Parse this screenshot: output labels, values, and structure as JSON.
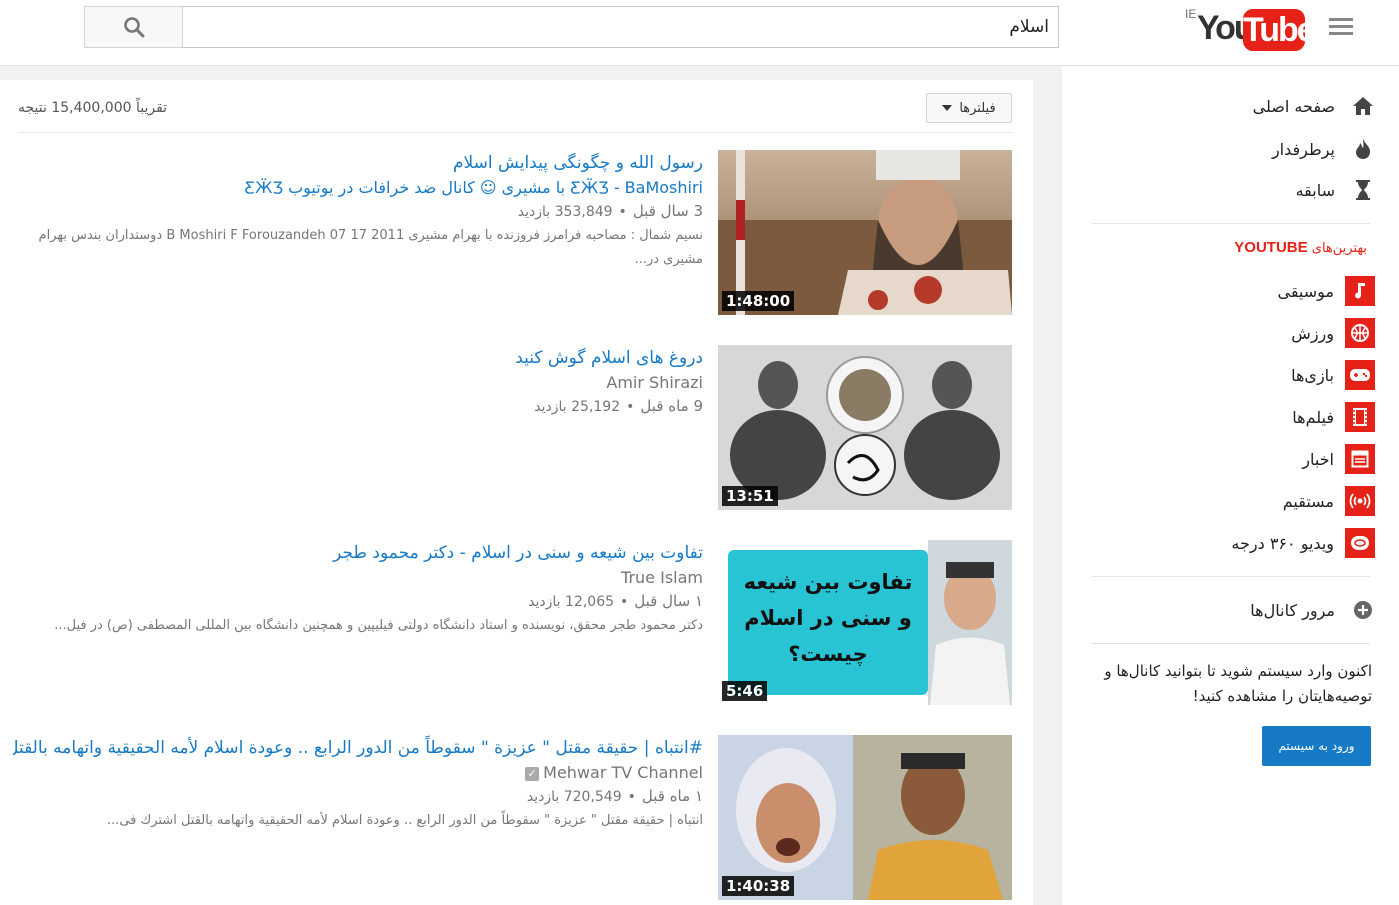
{
  "header": {
    "search_value": "اسلام",
    "logo_ie": "IE",
    "logo_you": "You",
    "logo_tube": "Tube"
  },
  "results": {
    "count_text": "تقریباً 15,400,000 نتیجه",
    "filter_label": "فیلترها",
    "videos": [
      {
        "title": "رسول الله و چگونگی پیدایش اسلام",
        "channel": "ƸӜƷ - BaMoshiri با مشیری ☺ کانال ضد خرافات در یوتیوب ƸӜƷ",
        "time_ago": "3 سال قبل",
        "views": "353,849 بازدید",
        "description": "نسیم شمال : مصاحبه فرامرز فروزنده با بهرام مشیری B Moshiri F Forouzandeh 07 17 2011 دوستداران بندس بهرام مشیری در...",
        "duration": "1:48:00"
      },
      {
        "title": "دروغ های اسلام گوش کنید",
        "channel": "Amir Shirazi",
        "time_ago": "9 ماه قبل",
        "views": "25,192 بازدید",
        "description": "",
        "duration": "13:51"
      },
      {
        "title": "تفاوت بین شیعه و سنی در اسلام - دکتر محمود طجر",
        "channel": "True Islam",
        "time_ago": "۱ سال قبل",
        "views": "12,065 بازدید",
        "description": "دکتر محمود طجر محقق، نویسنده و استاد دانشگاه دولتی فیلیپین و همچنین دانشگاه بین المللی المصطفی (ص) در فیل...",
        "duration": "5:46",
        "thumb_text": "تفاوت بین شیعه و سنی در اسلام چیست؟"
      },
      {
        "title": "#انتباه | حقيقة مقتل \" عزيزة \" سقوطاً من الدور الرابع .. وعودة اسلام لأمه الحقيقية واتهامه بالقتل",
        "channel": "Mehwar TV Channel",
        "time_ago": "۱ ماه قبل",
        "views": "720,549 بازدید",
        "description": "انتباه | حقيقة مقتل \" عزيزة \" سقوطاً من الدور الرابع .. وعودة اسلام لأمه الحقيقية واتهامه بالقتل اشترك فى...",
        "duration": "1:40:38"
      }
    ]
  },
  "sidebar": {
    "nav": [
      {
        "label": "صفحه اصلی",
        "icon": "home-icon"
      },
      {
        "label": "پرطرفدار",
        "icon": "flame-icon"
      },
      {
        "label": "سابقه",
        "icon": "hourglass-icon"
      }
    ],
    "best_title_prefix": "بهترین‌های",
    "best_title_brand": "YOUTUBE",
    "categories": [
      {
        "label": "موسیقی",
        "icon": "music-icon"
      },
      {
        "label": "ورزش",
        "icon": "sports-icon"
      },
      {
        "label": "بازی‌ها",
        "icon": "gamepad-icon"
      },
      {
        "label": "فیلم‌ها",
        "icon": "film-icon"
      },
      {
        "label": "اخبار",
        "icon": "news-icon"
      },
      {
        "label": "مستقیم",
        "icon": "live-icon"
      },
      {
        "label": "ویدیو ۳۶۰ درجه",
        "icon": "360-video-icon"
      }
    ],
    "browse_channels": "مرور کانال‌ها",
    "signin_text": "اکنون وارد سیستم شوید تا بتوانید کانال‌ها و توصیه‌هایتان را مشاهده کنید!",
    "signin_button": "ورود به سیستم"
  }
}
